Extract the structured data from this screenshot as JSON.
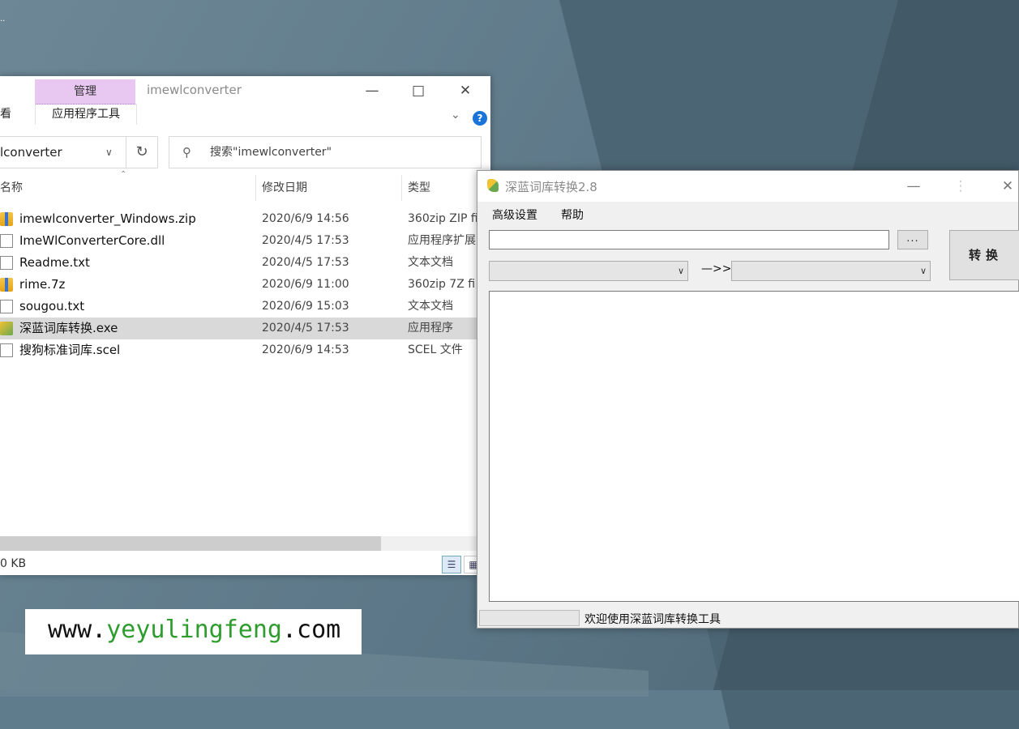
{
  "explorer": {
    "ribbon_context_tab": "管理",
    "ribbon_context_sub": "应用程序工具",
    "ribbon_view_tab": "查看",
    "window_title": "imewlconverter",
    "address_text": "lconverter",
    "search_placeholder": "搜索\"imewlconverter\"",
    "columns": {
      "name": "名称",
      "date": "修改日期",
      "type": "类型"
    },
    "files": [
      {
        "name": "imewlconverter_Windows.zip",
        "date": "2020/6/9 14:56",
        "type": "360zip ZIP fi",
        "icon": "zip-icon"
      },
      {
        "name": "ImeWlConverterCore.dll",
        "date": "2020/4/5 17:53",
        "type": "应用程序扩展",
        "icon": "dll-icon"
      },
      {
        "name": "Readme.txt",
        "date": "2020/4/5 17:53",
        "type": "文本文档",
        "icon": "text-file-icon"
      },
      {
        "name": "rime.7z",
        "date": "2020/6/9 11:00",
        "type": "360zip 7Z fi",
        "icon": "zip-icon"
      },
      {
        "name": "sougou.txt",
        "date": "2020/6/9 15:03",
        "type": "文本文档",
        "icon": "text-file-icon"
      },
      {
        "name": "深蓝词库转换.exe",
        "date": "2020/4/5 17:53",
        "type": "应用程序",
        "icon": "exe-icon"
      },
      {
        "name": "搜狗标准词库.scel",
        "date": "2020/6/9 14:53",
        "type": "SCEL 文件",
        "icon": "file-icon"
      }
    ],
    "selected_index": 5,
    "status_text": "0 KB"
  },
  "converter": {
    "title": "深蓝词库转换2.8",
    "menu": {
      "advanced": "高级设置",
      "help": "帮助"
    },
    "browse_label": "...",
    "convert_label": "转换",
    "arrow_label": "—>>",
    "path_value": "",
    "status_text": "欢迎使用深蓝词库转换工具"
  },
  "watermark": {
    "prefix": "www.",
    "domain": "yeyulingfeng",
    "suffix": ".com"
  }
}
